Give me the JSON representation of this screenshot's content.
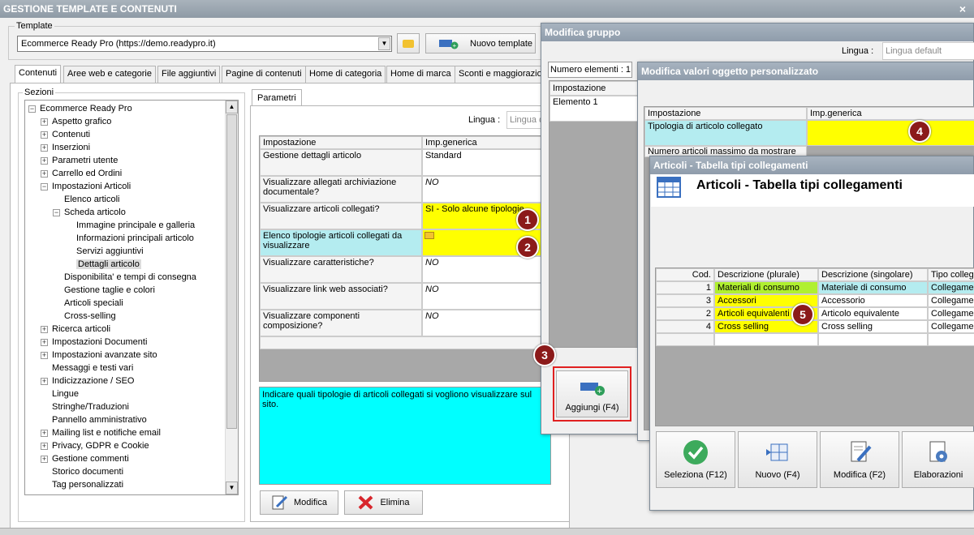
{
  "window": {
    "title": "GESTIONE TEMPLATE E CONTENUTI",
    "close": "×"
  },
  "template": {
    "label": "Template",
    "value": "Ecommerce Ready Pro (https://demo.readypro.it)",
    "new_button": "Nuovo template"
  },
  "tabs": [
    "Contenuti",
    "Aree web e categorie",
    "File aggiuntivi",
    "Pagine di contenuti",
    "Home di categoria",
    "Home di marca",
    "Sconti e maggiorazio"
  ],
  "sections": {
    "label": "Sezioni",
    "items": [
      {
        "label": "Ecommerce Ready Pro",
        "exp": "−"
      },
      {
        "label": "Aspetto grafico",
        "exp": "+"
      },
      {
        "label": "Contenuti",
        "exp": "+"
      },
      {
        "label": "Inserzioni",
        "exp": "+"
      },
      {
        "label": "Parametri utente",
        "exp": "+"
      },
      {
        "label": "Carrello ed Ordini",
        "exp": "+"
      },
      {
        "label": "Impostazioni Articoli",
        "exp": "−"
      },
      {
        "label": "Elenco articoli",
        "exp": ""
      },
      {
        "label": "Scheda articolo",
        "exp": "−"
      },
      {
        "label": "Immagine principale e galleria",
        "exp": ""
      },
      {
        "label": "Informazioni principali articolo",
        "exp": ""
      },
      {
        "label": "Servizi aggiuntivi",
        "exp": ""
      },
      {
        "label": "Dettagli articolo",
        "exp": ""
      },
      {
        "label": "Disponibilita' e tempi di consegna",
        "exp": ""
      },
      {
        "label": "Gestione taglie e colori",
        "exp": ""
      },
      {
        "label": "Articoli speciali",
        "exp": ""
      },
      {
        "label": "Cross-selling",
        "exp": ""
      },
      {
        "label": "Ricerca articoli",
        "exp": "+"
      },
      {
        "label": "Impostazioni Documenti",
        "exp": "+"
      },
      {
        "label": "Impostazioni avanzate sito",
        "exp": "+"
      },
      {
        "label": "Messaggi e testi vari",
        "exp": ""
      },
      {
        "label": "Indicizzazione / SEO",
        "exp": "+"
      },
      {
        "label": "Lingue",
        "exp": ""
      },
      {
        "label": "Stringhe/Traduzioni",
        "exp": ""
      },
      {
        "label": "Pannello amministrativo",
        "exp": ""
      },
      {
        "label": "Mailing list e notifiche email",
        "exp": "+"
      },
      {
        "label": "Privacy, GDPR e Cookie",
        "exp": "+"
      },
      {
        "label": "Gestione commenti",
        "exp": "+"
      },
      {
        "label": "Storico documenti",
        "exp": ""
      },
      {
        "label": "Tag personalizzati",
        "exp": ""
      }
    ]
  },
  "params": {
    "tab": "Parametri",
    "lingua_label": "Lingua :",
    "lingua_value": "Lingua d",
    "col1": "Impostazione",
    "col2": "Imp.generica",
    "rows": [
      {
        "name": "Gestione dettagli articolo",
        "value": "Standard"
      },
      {
        "name": "Visualizzare allegati archiviazione documentale?",
        "value": "NO"
      },
      {
        "name": "Visualizzare articoli collegati?",
        "value": "SI - Solo alcune tipologie"
      },
      {
        "name": "Elenco tipologie articoli collegati da visualizzare",
        "value": ""
      },
      {
        "name": "Visualizzare caratteristiche?",
        "value": "NO"
      },
      {
        "name": "Visualizzare link web associati?",
        "value": "NO"
      },
      {
        "name": "Visualizzare componenti composizione?",
        "value": "NO"
      }
    ],
    "description": "Indicare quali tipologie di articoli collegati si vogliono visualizzare sul sito.",
    "modifica": "Modifica",
    "elimina": "Elimina"
  },
  "modifica_gruppo": {
    "title": "Modifica gruppo",
    "lingua_label": "Lingua :",
    "lingua_value": "Lingua default",
    "numero": "Numero elementi : 1",
    "col": "Impostazione",
    "row": "Elemento 1",
    "aggiungi": "Aggiungi (F4)"
  },
  "modifica_valori": {
    "title": "Modifica valori oggetto personalizzato",
    "col1": "Impostazione",
    "col2": "Imp.generica",
    "row1": "Tipologia di articolo collegato",
    "row2": "Numero articoli massimo da mostrare"
  },
  "tabella": {
    "title": "Articoli - Tabella tipi collegamenti",
    "heading": "Articoli - Tabella tipi collegamenti",
    "headers": [
      "Cod.",
      "Descrizione (plurale)",
      "Descrizione (singolare)",
      "Tipo collega"
    ],
    "rows": [
      {
        "cod": "1",
        "plurale": "Materiali di consumo",
        "singolare": "Materiale di consumo",
        "tipo": "Collegamen"
      },
      {
        "cod": "3",
        "plurale": "Accessori",
        "singolare": "Accessorio",
        "tipo": "Collegamen"
      },
      {
        "cod": "2",
        "plurale": "Articoli equivalenti",
        "singolare": "Articolo equivalente",
        "tipo": "Collegamen"
      },
      {
        "cod": "4",
        "plurale": "Cross selling",
        "singolare": "Cross selling",
        "tipo": "Collegamen"
      }
    ],
    "buttons": [
      "Seleziona (F12)",
      "Nuovo (F4)",
      "Modifica (F2)",
      "Elaborazioni"
    ]
  },
  "badges": [
    "1",
    "2",
    "3",
    "4",
    "5"
  ],
  "colors": {
    "yellow": "#ffff00",
    "cyan": "#00ffff",
    "light_cyan": "#b4ecf0",
    "red_box": "#e02020",
    "badge": "#8b1a1a"
  }
}
